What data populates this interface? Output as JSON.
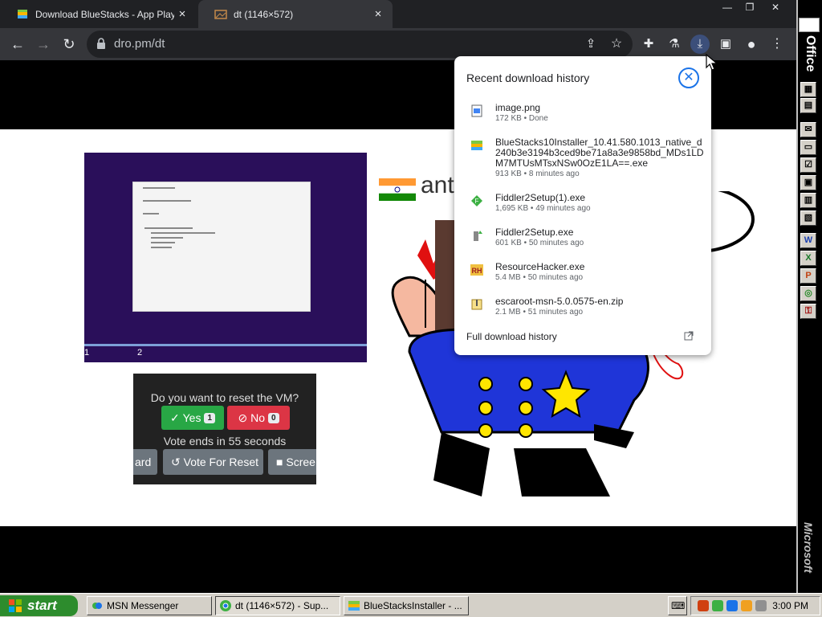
{
  "browser": {
    "tabs": [
      {
        "label": "Download BlueStacks - App Player o",
        "close": "×",
        "active": false
      },
      {
        "label": "dt (1146×572)",
        "close": "×",
        "active": true
      }
    ],
    "window_controls": {
      "minimize": "—",
      "restore": "❐",
      "close": "✕"
    },
    "url": "dro.pm/dt"
  },
  "vm_screenshot": {
    "step1": "1",
    "step2": "2"
  },
  "vote": {
    "question": "Do you want to reset the VM?",
    "yes_label": "Yes",
    "yes_count": "1",
    "no_label": "No",
    "no_count": "0",
    "timer": "Vote ends in 55 seconds",
    "btn_left": "ard",
    "btn_reset": "Vote For Reset",
    "btn_screen": "Scree"
  },
  "banner_text": "ant",
  "downloads": {
    "title": "Recent download history",
    "items": [
      {
        "name": "image.png",
        "meta": "172 KB • Done",
        "icon": "image-file-icon"
      },
      {
        "name": "BlueStacks10Installer_10.41.580.1013_native_d240b3e3194b3ced9be71a8a3e9858bd_MDs1LDM7MTUsMTsxNSw0OzE1LA==.exe",
        "meta": "913 KB • 8 minutes ago",
        "icon": "bluestacks-icon"
      },
      {
        "name": "Fiddler2Setup(1).exe",
        "meta": "1,695 KB • 49 minutes ago",
        "icon": "fiddler-icon"
      },
      {
        "name": "Fiddler2Setup.exe",
        "meta": "601 KB • 50 minutes ago",
        "icon": "installer-icon"
      },
      {
        "name": "ResourceHacker.exe",
        "meta": "5.4 MB • 50 minutes ago",
        "icon": "resource-hacker-icon"
      },
      {
        "name": "escaroot-msn-5.0.0575-en.zip",
        "meta": "2.1 MB • 51 minutes ago",
        "icon": "zip-icon"
      }
    ],
    "full_history": "Full download history"
  },
  "office_bar": {
    "label": "Office",
    "bottom": "Microsoft",
    "buttons": [
      "folder-icon",
      "calendar-icon",
      "contacts-icon",
      "mail-icon",
      "note-icon",
      "task-icon",
      "card-icon",
      "journal-icon",
      "word-icon",
      "excel-icon",
      "powerpoint-icon",
      "schedule-icon",
      "access-icon"
    ]
  },
  "taskbar": {
    "start": "start",
    "buttons": [
      {
        "label": "MSN Messenger",
        "active": false
      },
      {
        "label": "dt (1146×572) - Sup...",
        "active": true
      },
      {
        "label": "BlueStacksInstaller - ...",
        "active": false
      }
    ],
    "clock": "3:00 PM"
  },
  "colors": {
    "chrome_dark": "#202124",
    "chrome_toolbar": "#35363a",
    "yes_green": "#28a745",
    "no_red": "#dc3545",
    "xp_start": "#2d8c2d",
    "accent_blue": "#1a73e8"
  }
}
